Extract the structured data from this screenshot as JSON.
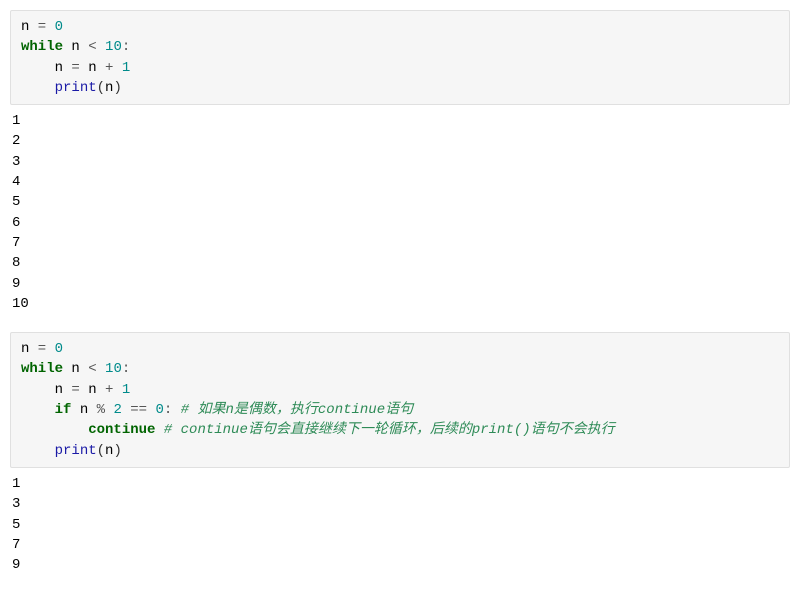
{
  "block1": {
    "l1": {
      "n": "n",
      "eq": " = ",
      "zero": "0"
    },
    "l2": {
      "kw_while": "while",
      "sp": " ",
      "n": "n",
      "lt": " < ",
      "ten": "10",
      "colon": ":"
    },
    "l3": {
      "indent": "    ",
      "n1": "n",
      "eq": " = ",
      "n2": "n",
      "plus": " + ",
      "one": "1"
    },
    "l4": {
      "indent": "    ",
      "fn": "print",
      "lp": "(",
      "n": "n",
      "rp": ")"
    }
  },
  "output1": "1\n2\n3\n4\n5\n6\n7\n8\n9\n10",
  "block2": {
    "l1": {
      "n": "n",
      "eq": " = ",
      "zero": "0"
    },
    "l2": {
      "kw_while": "while",
      "sp": " ",
      "n": "n",
      "lt": " < ",
      "ten": "10",
      "colon": ":"
    },
    "l3": {
      "indent": "    ",
      "n1": "n",
      "eq": " = ",
      "n2": "n",
      "plus": " + ",
      "one": "1"
    },
    "l4": {
      "indent": "    ",
      "kw_if": "if",
      "sp": " ",
      "n": "n",
      "mod": " % ",
      "two": "2",
      "eqeq": " == ",
      "zero": "0",
      "colon": ":",
      "sp2": " ",
      "cmt": "# 如果n是偶数，执行continue语句"
    },
    "l5": {
      "indent": "        ",
      "kw_continue": "continue",
      "sp": " ",
      "cmt": "# continue语句会直接继续下一轮循环，后续的print()语句不会执行"
    },
    "l6": {
      "indent": "    ",
      "fn": "print",
      "lp": "(",
      "n": "n",
      "rp": ")"
    }
  },
  "output2": "1\n3\n5\n7\n9"
}
